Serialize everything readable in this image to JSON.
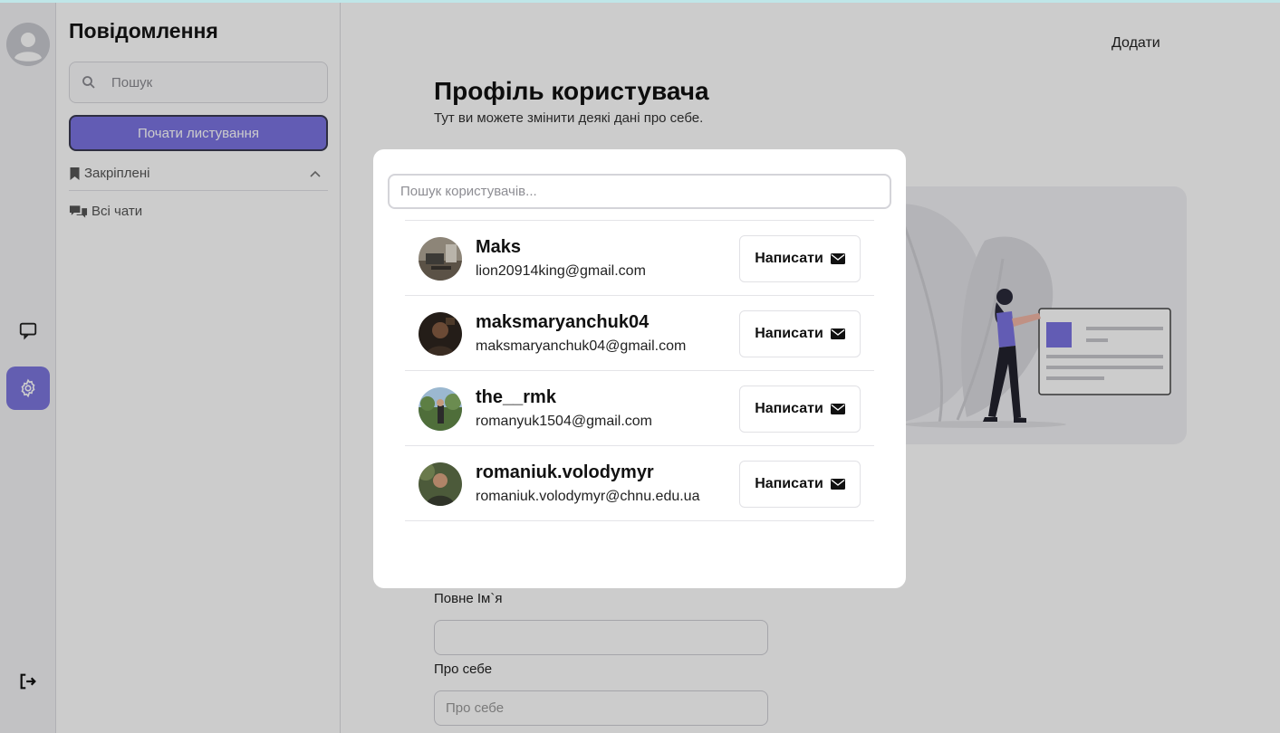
{
  "sidebar": {
    "title": "Повідомлення",
    "search_placeholder": "Пошук",
    "start_button": "Почати листування",
    "pinned_label": "Закріплені",
    "all_chats_label": "Всі чати"
  },
  "main": {
    "add_link": "Додати",
    "profile_title": "Профіль користувача",
    "profile_subtitle": "Тут ви можете змінити деякі дані про себе.",
    "full_name_label": "Повне Ім`я",
    "full_name_value": "",
    "about_label": "Про себе",
    "about_placeholder": "Про себе"
  },
  "modal": {
    "search_placeholder": "Пошук користувачів...",
    "write_label": "Написати",
    "users": [
      {
        "name": "Maks",
        "email": "lion20914king@gmail.com"
      },
      {
        "name": "maksmaryanchuk04",
        "email": "maksmaryanchuk04@gmail.com"
      },
      {
        "name": "the__rmk",
        "email": "romanyuk1504@gmail.com"
      },
      {
        "name": "romaniuk.volodymyr",
        "email": "romaniuk.volodymyr@chnu.edu.ua"
      }
    ]
  },
  "colors": {
    "accent": "#7b74e2",
    "overlay": "rgba(0,0,0,0.2)"
  },
  "icons": [
    "user-avatar-icon",
    "chat-icon",
    "gear-icon",
    "logout-icon",
    "search-icon",
    "bookmark-icon",
    "chevron-up-icon",
    "chats-icon",
    "envelope-icon"
  ]
}
